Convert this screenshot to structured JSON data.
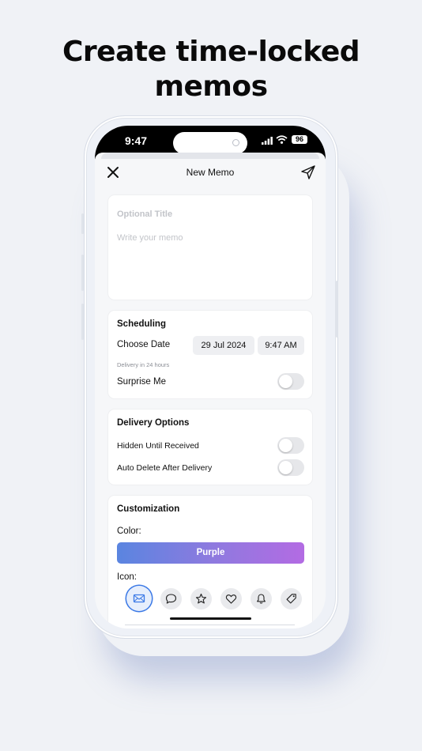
{
  "headline": {
    "line1": "Create time-locked",
    "line2": "memos"
  },
  "status_bar": {
    "time": "9:47",
    "battery": "96"
  },
  "nav": {
    "title": "New Memo",
    "close_icon": "close-icon",
    "send_icon": "send-icon"
  },
  "memo": {
    "title_placeholder": "Optional Title",
    "body_placeholder": "Write your memo"
  },
  "scheduling": {
    "title": "Scheduling",
    "date_label": "Choose Date",
    "date_value": "29 Jul 2024",
    "time_value": "9:47 AM",
    "note": "Delivery in 24 hours",
    "surprise_label": "Surprise Me",
    "surprise_on": false
  },
  "delivery": {
    "title": "Delivery Options",
    "hidden_label": "Hidden Until Received",
    "hidden_on": false,
    "auto_delete_label": "Auto Delete After Delivery",
    "auto_delete_on": false
  },
  "customization": {
    "title": "Customization",
    "color_label": "Color:",
    "color_value": "Purple",
    "icon_label": "Icon:",
    "icons": [
      "envelope-icon",
      "speech-bubble-icon",
      "star-icon",
      "heart-icon",
      "bell-icon",
      "tag-icon"
    ],
    "selected_icon": "envelope-icon"
  },
  "colors": {
    "accent_blue": "#3b79e6",
    "gradient_start": "#5a85e0",
    "gradient_end": "#b36be3"
  }
}
